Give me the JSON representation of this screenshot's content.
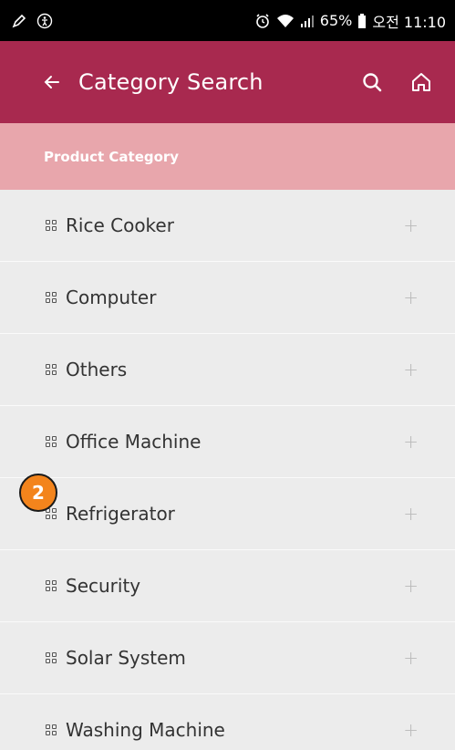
{
  "status_bar": {
    "battery": "65%",
    "time": "오전 11:10"
  },
  "app_bar": {
    "title": "Category Search",
    "back_icon": "arrow-left-icon",
    "search_icon": "search-icon",
    "home_icon": "home-icon",
    "color": "#a8294f"
  },
  "section_header": {
    "label": "Product Category",
    "color": "#e8a6ac"
  },
  "categories": [
    {
      "label": "Rice Cooker",
      "action": "+"
    },
    {
      "label": "Computer",
      "action": "+"
    },
    {
      "label": "Others",
      "action": "+"
    },
    {
      "label": "Office Machine",
      "action": "+"
    },
    {
      "label": "Refrigerator",
      "action": "+"
    },
    {
      "label": "Security",
      "action": "+"
    },
    {
      "label": "Solar System",
      "action": "+"
    },
    {
      "label": "Washing Machine",
      "action": "+"
    }
  ],
  "annotation": {
    "step_number": "2",
    "color": "#f3841c"
  }
}
